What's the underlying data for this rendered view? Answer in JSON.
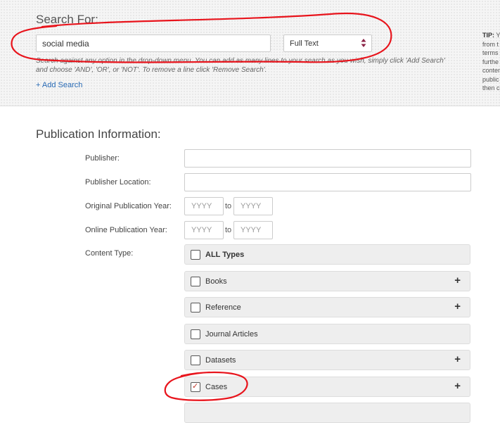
{
  "search": {
    "heading": "Search For:",
    "term_value": "social media",
    "field_selected": "Full Text",
    "help_text": "Search against any option in the drop-down menu. You can add as many lines to your search as you wish, simply click 'Add Search' and choose 'AND', 'OR', or 'NOT'. To remove a line click 'Remove Search'.",
    "add_search_label": "+ Add Search"
  },
  "tip": {
    "title": "TIP:",
    "lines": [
      "from t",
      "terms",
      "furthe",
      "conten",
      "public",
      "then c"
    ]
  },
  "publication": {
    "heading": "Publication Information:",
    "publisher_label": "Publisher:",
    "publisher_location_label": "Publisher Location:",
    "original_year_label": "Original Publication Year:",
    "online_year_label": "Online Publication Year:",
    "year_placeholder": "YYYY",
    "to_label": "to",
    "content_type_label": "Content Type:"
  },
  "content_types": [
    {
      "label": "ALL Types",
      "checked": false,
      "expandable": false
    },
    {
      "label": "Books",
      "checked": false,
      "expandable": true
    },
    {
      "label": "Reference",
      "checked": false,
      "expandable": true
    },
    {
      "label": "Journal Articles",
      "checked": false,
      "expandable": false
    },
    {
      "label": "Datasets",
      "checked": false,
      "expandable": true
    },
    {
      "label": "Cases",
      "checked": true,
      "expandable": true
    }
  ],
  "icons": {
    "expand": "plus-icon",
    "select": "sort-arrows-icon",
    "check": "checkmark-icon"
  },
  "colors": {
    "link": "#2a6bb5",
    "annotation": "#e8141c",
    "select_arrows": "#8b2346"
  }
}
